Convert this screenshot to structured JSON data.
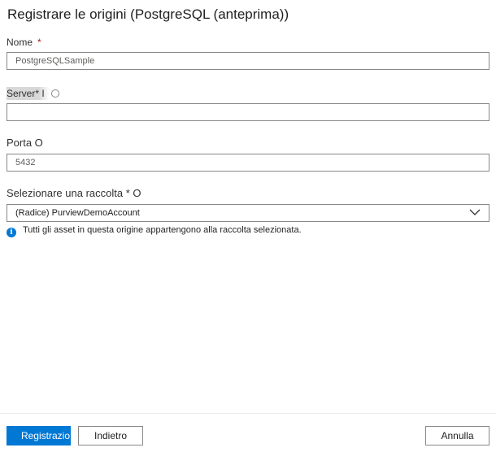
{
  "header": {
    "title": "Registrare le origini (PostgreSQL (anteprima))"
  },
  "form": {
    "name": {
      "label": "Nome",
      "required_mark": "*",
      "value": "PostgreSQLSample"
    },
    "server": {
      "label": "Server* I",
      "value": ""
    },
    "port": {
      "label": "Porta O",
      "value": "5432"
    },
    "collection": {
      "label": "Selezionare una raccolta * O",
      "selected": "(Radice) PurviewDemoAccount",
      "info_text": "Tutti gli asset in questa origine appartengono alla raccolta selezionata."
    }
  },
  "footer": {
    "register_label": "Registrazio",
    "back_label": "Indietro",
    "cancel_label": "Annulla"
  },
  "colors": {
    "accent": "#0078d4",
    "required": "#a4262c",
    "border": "#8a8886"
  },
  "icons": {
    "info": "info-icon",
    "dropdown": "chevron-down-icon"
  }
}
